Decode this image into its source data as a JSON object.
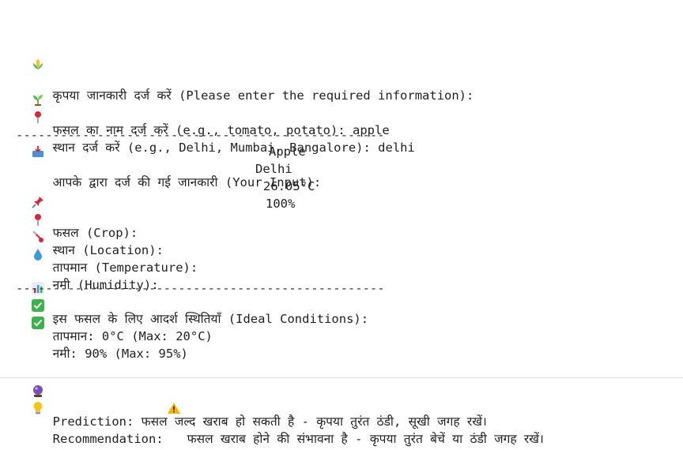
{
  "intro": {
    "text": "कृपया जानकारी दर्ज करें (Please enter the required information):",
    "icon": "corn-icon"
  },
  "inputs": {
    "crop_prompt": "फसल का नाम दर्ज करें (e.g., tomato, potato): apple",
    "crop_icon": "seedling-icon",
    "location_prompt": "स्थान दर्ज करें (e.g., Delhi, Mumbai, Bangalore): delhi",
    "location_icon": "pin-icon"
  },
  "your_input": {
    "heading": "आपके द्वारा दर्ज की गई जानकारी (Your Input):",
    "icon": "inbox-icon"
  },
  "separator": "--------------------------------------------------",
  "details": [
    {
      "label": "फसल (Crop):",
      "value": "Apple",
      "icon": "pushpin-icon"
    },
    {
      "label": "स्थान (Location):",
      "value": "Delhi",
      "icon": "pin-icon"
    },
    {
      "label": "तापमान (Temperature):",
      "value": "26.05°C",
      "icon": "thermometer-icon"
    },
    {
      "label": "नमी (Humidity):",
      "value": "100%",
      "icon": "droplet-icon"
    }
  ],
  "ideal": {
    "heading": "इस फसल के लिए आदर्श स्थितियाँ (Ideal Conditions):",
    "icon": "bar-chart-icon",
    "items": [
      {
        "text": "तापमान: 0°C (Max: 20°C)",
        "icon": "check-icon"
      },
      {
        "text": "नमी: 90% (Max: 95%)",
        "icon": "check-icon"
      }
    ]
  },
  "prediction": {
    "text": "Prediction: फसल जल्द खराब हो सकती है - कृपया तुरंत ठंडी, सूखी जगह रखें।",
    "icon": "crystal-ball-icon"
  },
  "recommendation": {
    "label": "Recommendation:",
    "text": "फसल खराब होने की संभावना है - कृपया तुरंत बेचें या ठंडी जगह रखें।",
    "icon": "lightbulb-icon",
    "warning_icon": "warning-icon"
  },
  "colors": {
    "text": "#222222",
    "check_green": "#3bb34a",
    "pin_red": "#d7263d",
    "warning_yellow": "#f5b400",
    "droplet_blue": "#3a9ad9"
  }
}
